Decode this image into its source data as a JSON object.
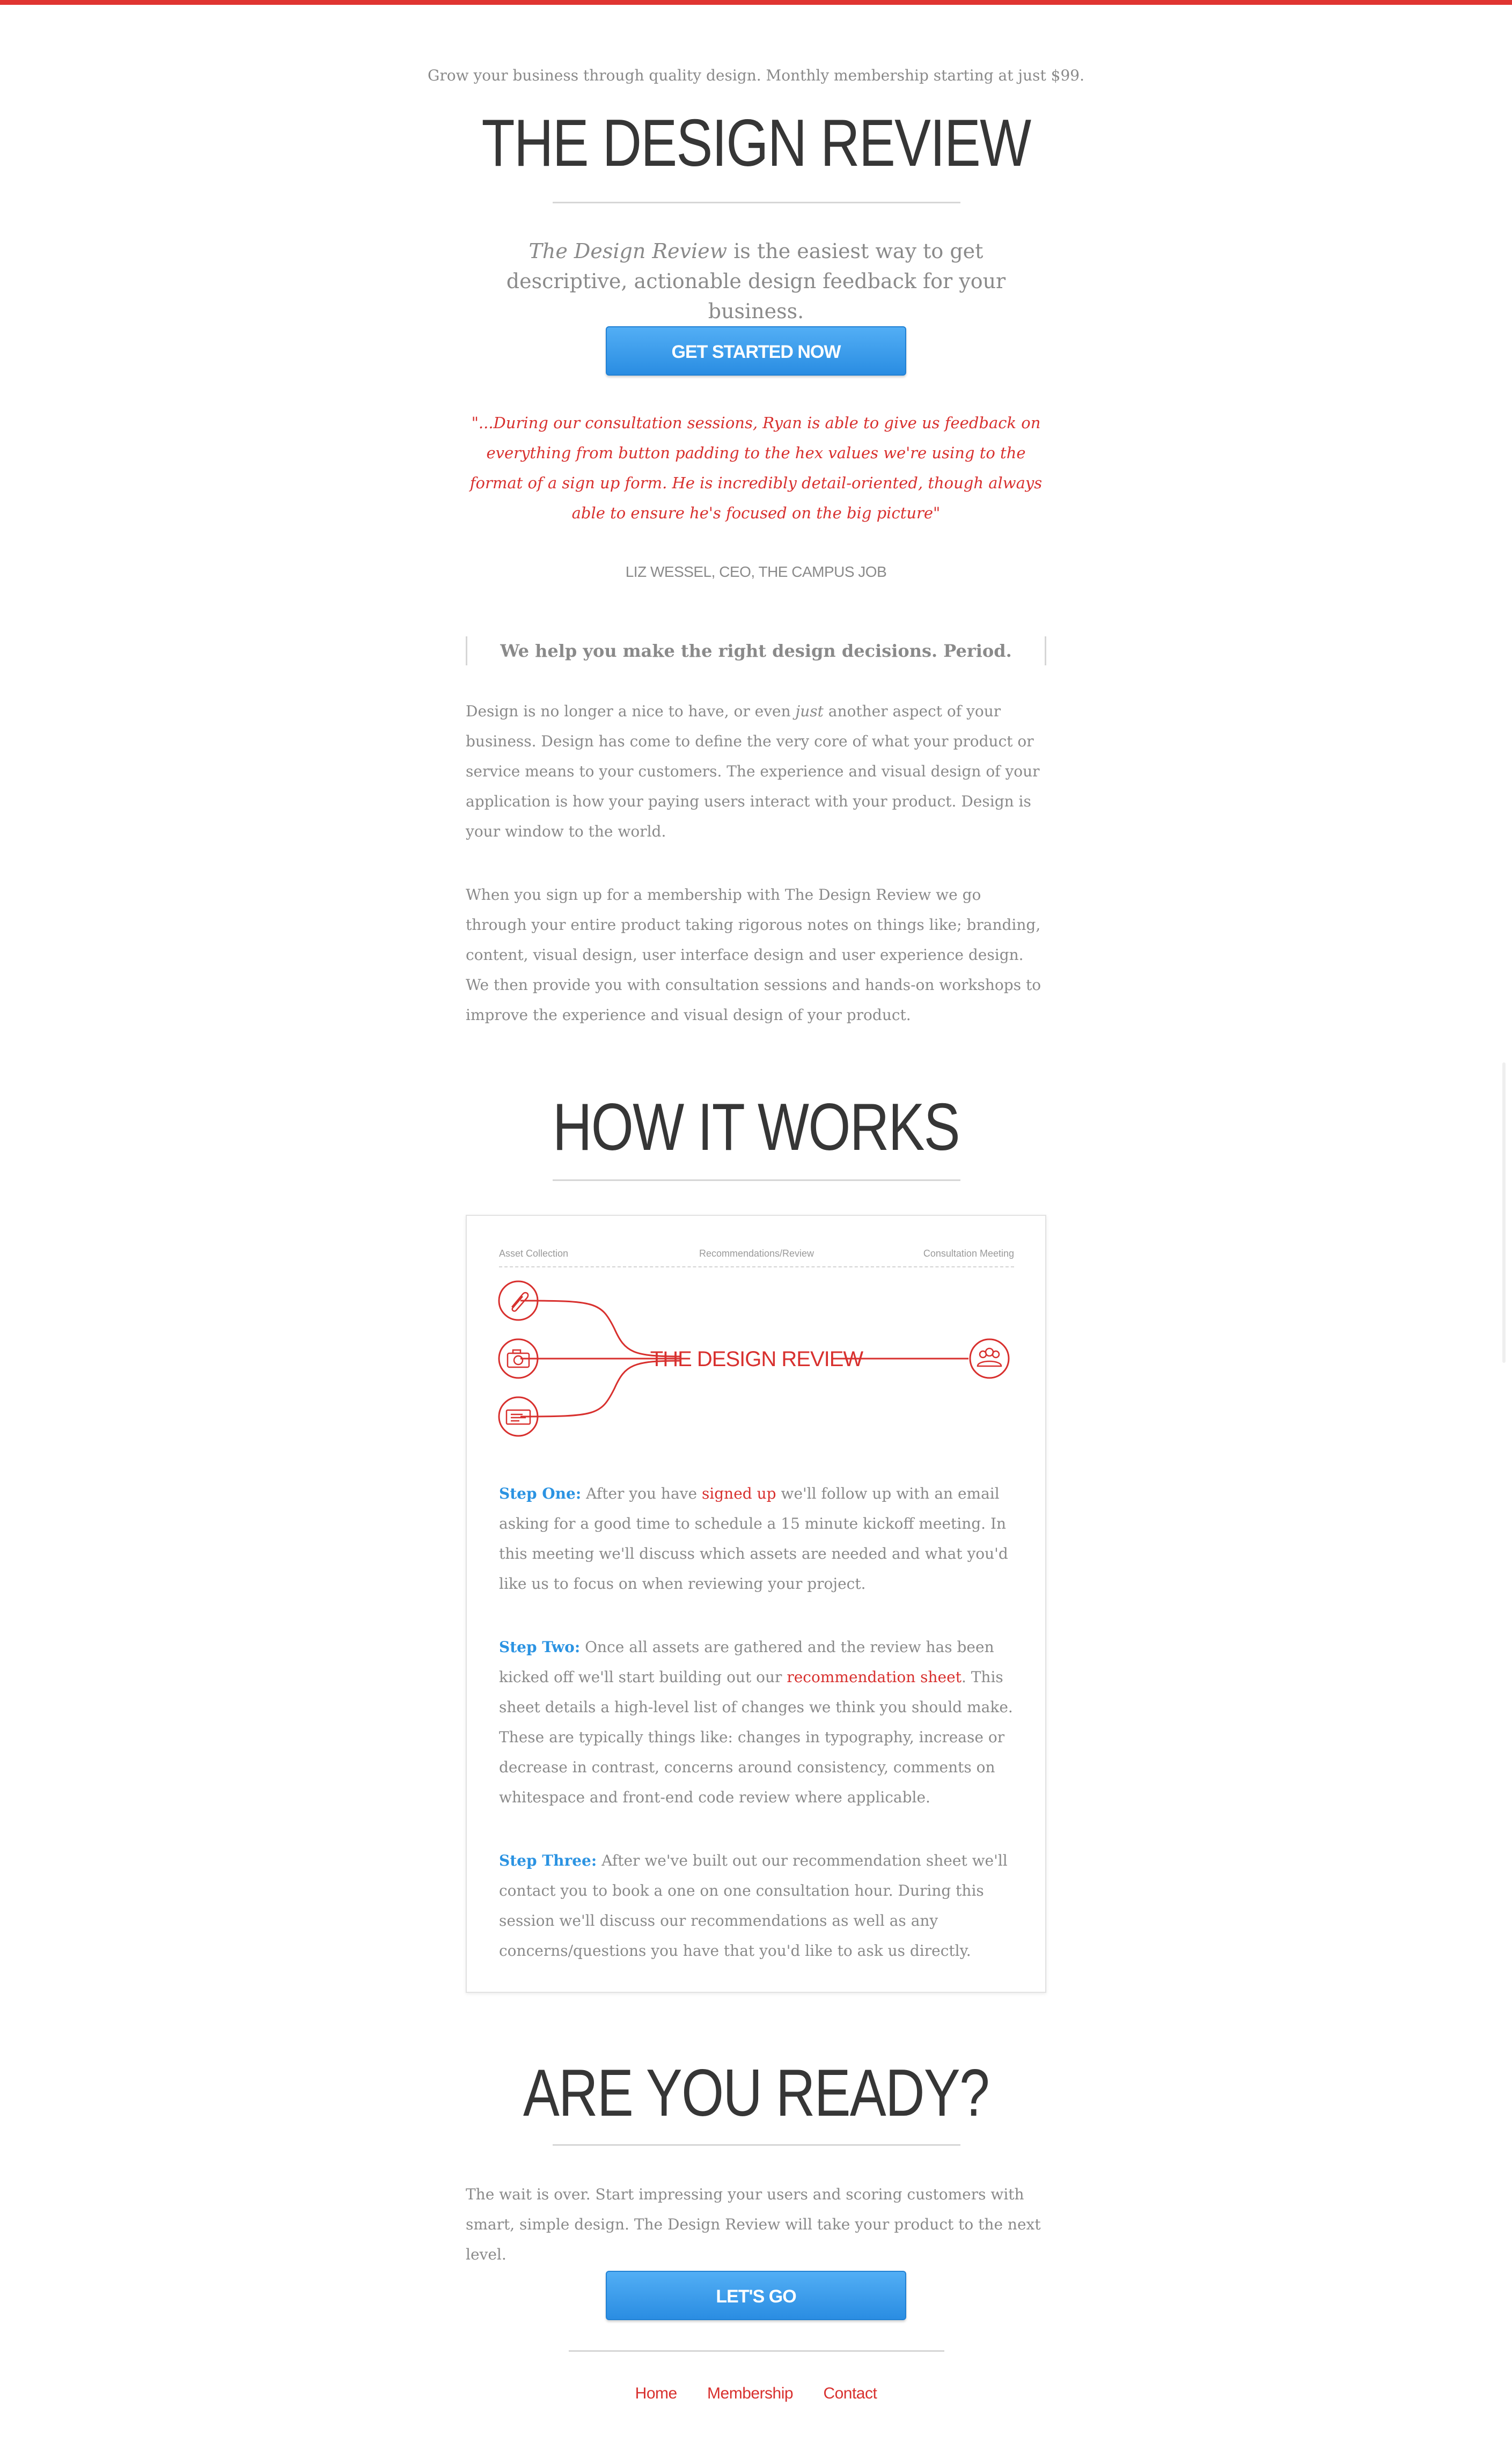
{
  "header": {
    "tagline": "Grow your business through quality design. Monthly membership starting at just $99.",
    "title": "THE DESIGN REVIEW",
    "lede_em": "The Design Review",
    "lede_rest": " is the easiest way to get descriptive, actionable design feedback for your business.",
    "cta_label": "GET STARTED NOW"
  },
  "testimonial": {
    "quote": "\"...During our consultation sessions, Ryan is able to give us feedback on everything from button padding to the hex values we're using to the format of a sign up form. He is incredibly detail-oriented, though always able to ensure he's focused on the big picture\"",
    "attribution": "LIZ WESSEL, CEO, THE CAMPUS JOB"
  },
  "intro": {
    "pullquote": "We help you make the right design decisions. Period.",
    "p1_a": "Design is no longer a nice to have, or even ",
    "p1_em": "just",
    "p1_b": " another aspect of your business. Design has come to define the very core of what your product or service means to your customers. The experience and visual design of your application is how your paying users interact with your product. Design is your window to the world.",
    "p2": "When you sign up for a membership with The Design Review we go through your entire product taking rigorous notes on things like; branding, content, visual design, user interface design and user experience design. We then provide you with consultation sessions and hands-on workshops to improve the experience and visual design of your product."
  },
  "how": {
    "title": "HOW IT WORKS",
    "diagram": {
      "label_left": "Asset Collection",
      "label_middle": "Recommendations/Review",
      "label_right": "Consultation Meeting",
      "center_text": "THE DESIGN REVIEW",
      "icons": [
        "paperclip-icon",
        "camera-icon",
        "document-icon",
        "people-icon"
      ],
      "accent": "#d8302e"
    },
    "step1_lead": "Step One:",
    "step1_a": " After you have ",
    "step1_link": "signed up",
    "step1_b": " we'll follow up with an email asking for a good time to schedule a 15 minute kickoff meeting. In this meeting we'll discuss which assets are needed and what you'd like us to focus on when reviewing your project.",
    "step2_lead": "Step Two:",
    "step2_a": " Once all assets are gathered and the review has been kicked off we'll start building out our ",
    "step2_link": "recommendation sheet",
    "step2_b": ". This sheet details a high-level list of changes we think you should make. These are typically things like: changes in typography, increase or decrease in contrast, concerns around consistency, comments on whitespace and front-end code review where applicable.",
    "step3_lead": "Step Three:",
    "step3_b": " After we've built out our recommendation sheet we'll contact you to book a one on one consultation hour. During this session we'll discuss our recommendations as well as any concerns/questions you have that you'd like to ask us directly."
  },
  "ready": {
    "title": "ARE YOU READY?",
    "text": "The wait is over. Start impressing your users and scoring customers with smart, simple design. The Design Review will take your product to the next level.",
    "cta_label": "LET'S GO"
  },
  "footer": {
    "links": [
      "Home",
      "Membership",
      "Contact"
    ]
  },
  "colors": {
    "accent_red": "#e03531",
    "button_blue": "#2a8de2",
    "step_blue": "#2b93e2"
  }
}
